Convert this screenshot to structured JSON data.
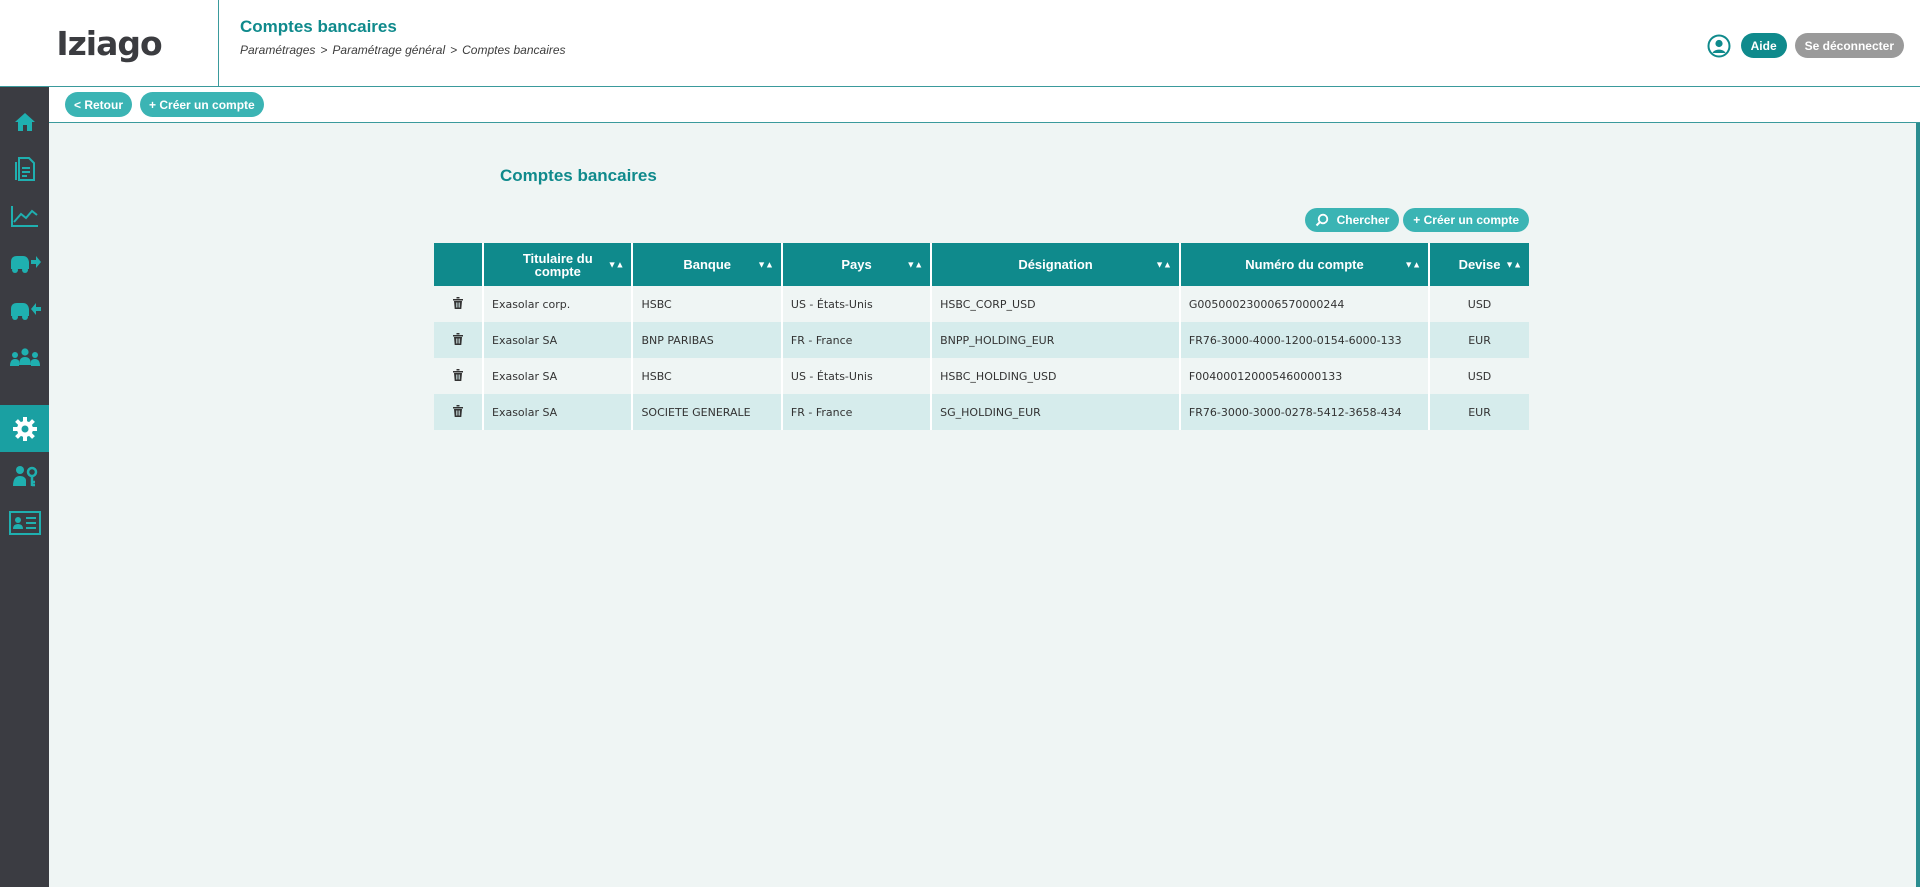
{
  "app": {
    "logo": "Iziago",
    "title": "Comptes bancaires",
    "breadcrumb": [
      "Paramétrages",
      "Paramétrage général",
      "Comptes bancaires"
    ],
    "breadcrumb_sep": ">",
    "help_label": "Aide",
    "logout_label": "Se déconnecter"
  },
  "toolbar": {
    "back_label": "< Retour",
    "create_label": "+ Créer un compte"
  },
  "sidebar": {
    "items": [
      {
        "icon": "home-icon",
        "active": false
      },
      {
        "icon": "document-icon",
        "active": false
      },
      {
        "icon": "chart-icon",
        "active": false
      },
      {
        "icon": "truck-out-icon",
        "active": false
      },
      {
        "icon": "truck-in-icon",
        "active": false
      },
      {
        "icon": "users-icon",
        "active": false
      },
      {
        "icon": "gear-icon",
        "active": true
      },
      {
        "icon": "user-key-icon",
        "active": false
      },
      {
        "icon": "id-card-icon",
        "active": false
      }
    ]
  },
  "main": {
    "section_title": "Comptes bancaires",
    "search_label": "Chercher",
    "create_label": "+ Créer un compte",
    "columns": [
      "",
      "Titulaire du compte",
      "Banque",
      "Pays",
      "Désignation",
      "Numéro du compte",
      "Devise"
    ],
    "rows": [
      [
        "Exasolar corp.",
        "HSBC",
        "US - États-Unis",
        "HSBC_CORP_USD",
        "G005000230006570000244",
        "USD"
      ],
      [
        "Exasolar SA",
        "BNP PARIBAS",
        "FR - France",
        "BNPP_HOLDING_EUR",
        "FR76-3000-4000-1200-0154-6000-133",
        "EUR"
      ],
      [
        "Exasolar SA",
        "HSBC",
        "US - États-Unis",
        "HSBC_HOLDING_USD",
        "F004000120005460000133",
        "USD"
      ],
      [
        "Exasolar SA",
        "SOCIETE GENERALE",
        "FR - France",
        "SG_HOLDING_EUR",
        "FR76-3000-3000-0278-5412-3658-434",
        "EUR"
      ]
    ]
  },
  "colors": {
    "teal": "#0f8a8c",
    "teal_light": "#3bb4b4",
    "sidebar": "#3b3c42",
    "row_alt": "#d6ecec"
  }
}
